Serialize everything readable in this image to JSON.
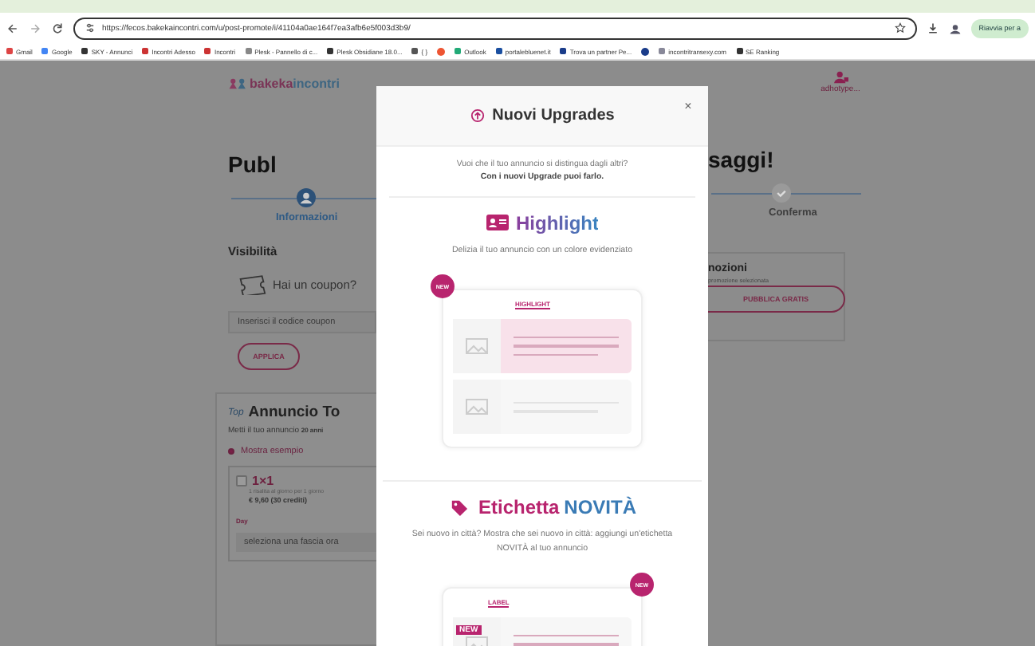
{
  "browser": {
    "url": "https://fecos.bakekaincontri.com/u/post-promote/i/41104a0ae164f7ea3afb6e5f003d3b9/",
    "update_button": "Riavvia per a",
    "bookmarks": [
      {
        "label": "Gmail"
      },
      {
        "label": "Google"
      },
      {
        "label": "SKY - Annunci"
      },
      {
        "label": "Incontri Adesso"
      },
      {
        "label": "Incontri"
      },
      {
        "label": "Plesk - Pannello di c..."
      },
      {
        "label": "Plesk Obsidiane 18.0..."
      },
      {
        "label": "{ }"
      },
      {
        "kind": "icon"
      },
      {
        "label": "Outlook"
      },
      {
        "label": "portalebluenet.it"
      },
      {
        "label": "Trova un partner Pe..."
      },
      {
        "kind": "icon"
      },
      {
        "label": "incontritransexy.com"
      },
      {
        "label": "SE Ranking"
      }
    ]
  },
  "header": {
    "logo": [
      "bakeka",
      "incontri"
    ],
    "user_label": "adhotype..."
  },
  "page": {
    "title_left": "Publ",
    "title_right": "saggi!",
    "steps": [
      {
        "label": "Informazioni",
        "selected": true
      },
      {
        "label": "Conferma",
        "selected": false
      }
    ],
    "visibility": "Visibilità",
    "coupon_question": "Hai un coupon?",
    "coupon_placeholder": "Inserisci il codice coupon",
    "apply_button": "APPLICA",
    "top_badge": "Top",
    "top_title": "Annuncio To",
    "top_text": "Metti il tuo annuncio",
    "top_text_bold": "20 anni",
    "example_option": {
      "label": "Mostra esempio",
      "selected": true
    },
    "plan": {
      "name": "1×1",
      "checked": false,
      "detail": "1 risalita al giorno per 1 giorno",
      "price": "€ 9,60 (30 crediti)"
    },
    "day_label": "Day",
    "day_placeholder": "seleziona una fascia ora",
    "promo_title": "nozioni",
    "promo_text": "promozione selezionata",
    "promo_button": "PUBBLICA GRATIS"
  },
  "modal": {
    "title": "Nuovi Upgrades",
    "close": "×",
    "intro": "Vuoi che il tuo annuncio si distingua dagli altri?",
    "intro_bold": "Con i nuovi Upgrade puoi farlo.",
    "upgrades": [
      {
        "kind": "highlight",
        "title": [
          "Highlight"
        ],
        "description": "Delizia il tuo annuncio con un colore evidenziato",
        "badge": "NEW",
        "tag": "HIGHLIGHT"
      },
      {
        "kind": "label",
        "title": [
          "Etichetta",
          "NOVITÀ"
        ],
        "description": "Sei nuovo in città? Mostra che sei nuovo in città: aggiungi un'etichetta NOVITÀ al tuo annuncio",
        "badge": "NEW",
        "tag": "LABEL",
        "mini_badge": "NEW"
      }
    ]
  }
}
